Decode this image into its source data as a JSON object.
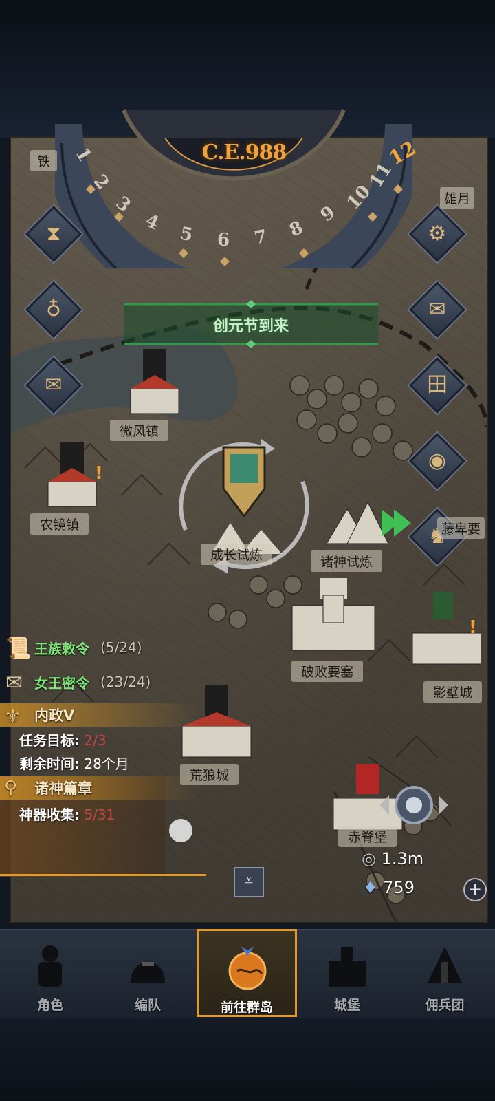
{
  "era": {
    "year": "C.E.988",
    "month": "12",
    "ring_numbers": [
      "1",
      "2",
      "3",
      "4",
      "5",
      "6",
      "7",
      "8",
      "9",
      "10",
      "11"
    ]
  },
  "banner": {
    "text": "创元节到来"
  },
  "locations": [
    {
      "name": "铁",
      "id": "top-left-city"
    },
    {
      "name": "雄月",
      "id": "top-right-city"
    },
    {
      "name": "微风镇",
      "id": "breeze-town"
    },
    {
      "name": "农镜镇",
      "id": "farm-town"
    },
    {
      "name": "成长试炼",
      "id": "growth-trial"
    },
    {
      "name": "诸神试炼",
      "id": "gods-trial"
    },
    {
      "name": "破败要塞",
      "id": "ruined-fortress"
    },
    {
      "name": "影壁城",
      "id": "shadow-city"
    },
    {
      "name": "荒狼城",
      "id": "wolf-city"
    },
    {
      "name": "赤脊堡",
      "id": "red-ridge-fort"
    },
    {
      "name": "藤卑要",
      "id": "right-edge-city"
    }
  ],
  "quests": {
    "royal": {
      "title": "王族敕令",
      "progress": "(5/24)"
    },
    "queen": {
      "title": "女王密令",
      "progress": "(23/24)"
    },
    "domestic": {
      "title": "内政V",
      "goal_label": "任务目标:",
      "goal_value": "2/3",
      "time_label": "剩余时间:",
      "time_value": "28个月"
    },
    "gods": {
      "title": "诸神篇章",
      "collect_label": "神器收集:",
      "collect_value": "5/31"
    }
  },
  "resources": {
    "silver": "1.3m",
    "crystal": "759"
  },
  "nav": [
    {
      "label": "角色",
      "icon": "knight-icon"
    },
    {
      "label": "编队",
      "icon": "helmet-icon"
    },
    {
      "label": "前往群岛",
      "icon": "islands-globe-icon"
    },
    {
      "label": "城堡",
      "icon": "castle-icon"
    },
    {
      "label": "佣兵团",
      "icon": "mercenary-icon"
    }
  ],
  "colors": {
    "accent": "#e29a25",
    "quest_green": "#7fe37a",
    "alert_red": "#c24545",
    "banner_green": "#2f9a4a"
  }
}
